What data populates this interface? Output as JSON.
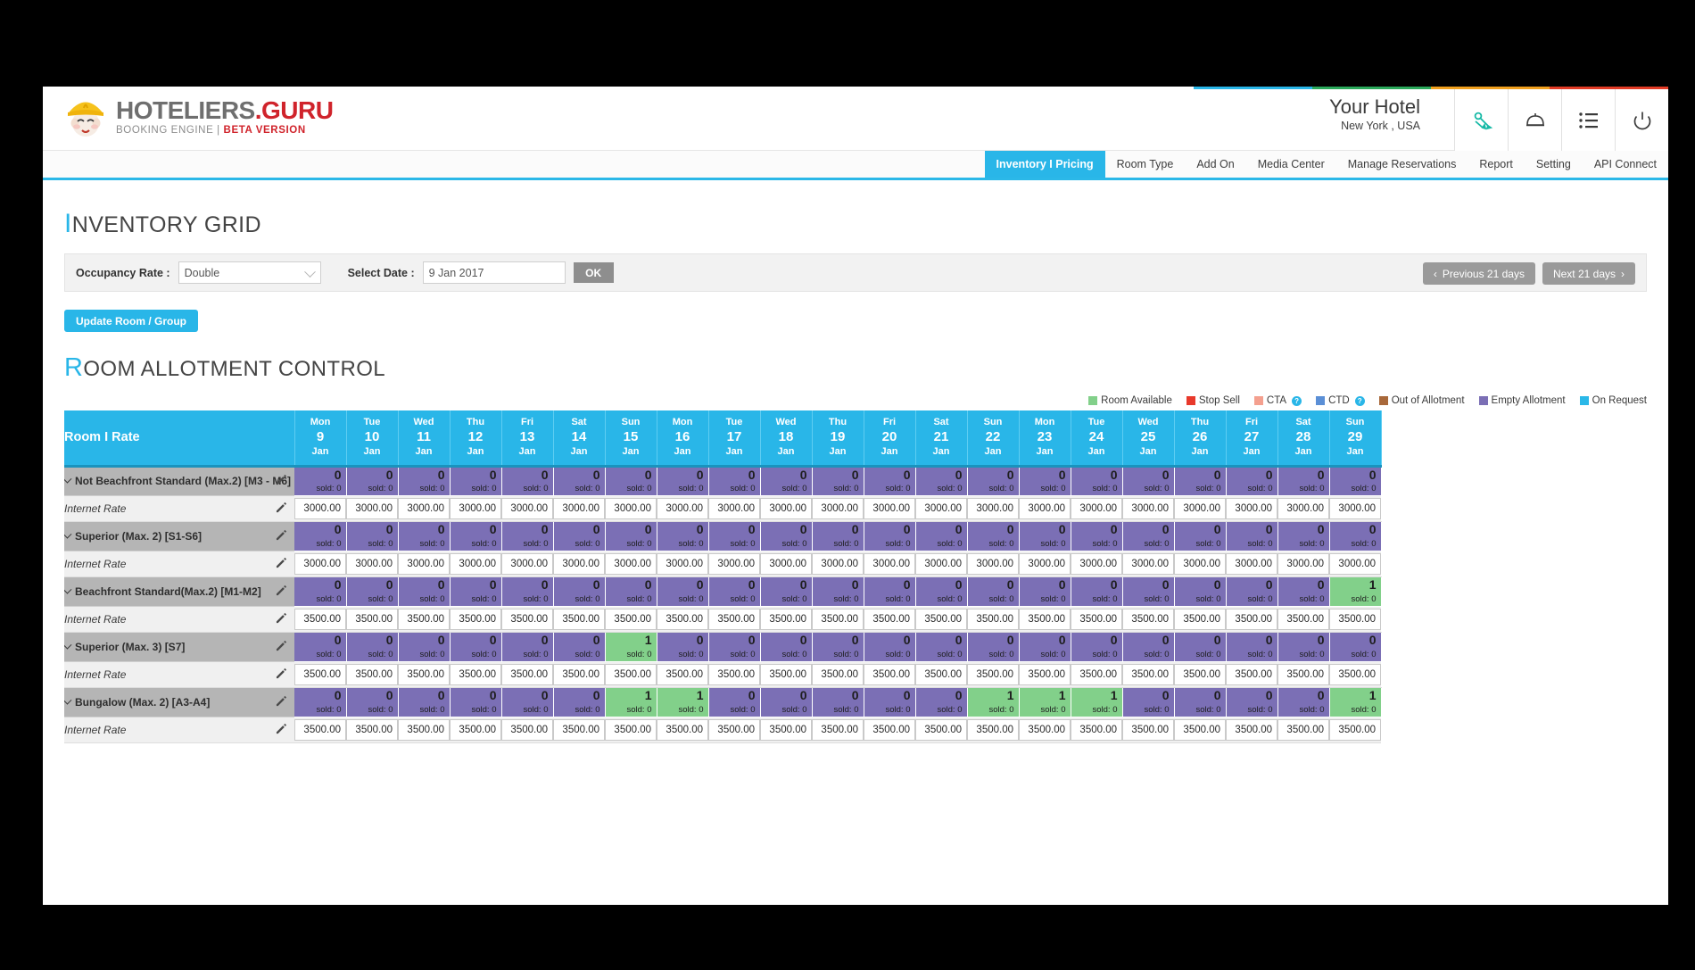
{
  "brand": {
    "name_main": "HOTELIERS",
    "name_accent": ".GURU",
    "tagline": "BOOKING ENGINE  |",
    "tagline_accent": "BETA VERSION",
    "accent_red": "#d0232b",
    "accent_blue": "#29b6e8"
  },
  "header": {
    "hotel_name": "Your Hotel",
    "hotel_location": "New York , USA",
    "icons": [
      "promotions-icon",
      "service-bell-icon",
      "list-icon",
      "power-icon"
    ],
    "strip_colors": [
      "#29b6e8",
      "#2aa85a",
      "#f0a01e",
      "#e23b26"
    ]
  },
  "nav": {
    "items": [
      {
        "label": "Inventory I Pricing",
        "active": true
      },
      {
        "label": "Room Type",
        "active": false
      },
      {
        "label": "Add On",
        "active": false
      },
      {
        "label": "Media Center",
        "active": false
      },
      {
        "label": "Manage Reservations",
        "active": false
      },
      {
        "label": "Report",
        "active": false
      },
      {
        "label": "Setting",
        "active": false
      },
      {
        "label": "API Connect",
        "active": false
      }
    ]
  },
  "page": {
    "title_cap": "I",
    "title_rest": "NVENTORY GRID",
    "section_cap": "R",
    "section_rest": "OOM ALLOTMENT CONTROL"
  },
  "filters": {
    "occupancy_label": "Occupancy Rate :",
    "occupancy_value": "Double",
    "date_label": "Select Date :",
    "date_value": "9 Jan 2017",
    "ok_label": "OK",
    "prev_label": "Previous 21 days",
    "next_label": "Next 21 days",
    "update_label": "Update Room / Group"
  },
  "legend": [
    {
      "label": "Room Available",
      "color": "#82d08a",
      "info": false
    },
    {
      "label": "Stop Sell",
      "color": "#e8392b",
      "info": false
    },
    {
      "label": "CTA",
      "color": "#f4a08f",
      "info": true
    },
    {
      "label": "CTD",
      "color": "#5b8fd6",
      "info": true
    },
    {
      "label": "Out of Allotment",
      "color": "#a8683a",
      "info": false
    },
    {
      "label": "Empty Allotment",
      "color": "#7b6fb5",
      "info": false
    },
    {
      "label": "On Request",
      "color": "#2bb8e8",
      "info": false
    }
  ],
  "grid": {
    "room_header": "Room I Rate",
    "rate_row_label": "Internet Rate",
    "sold_prefix": "sold: ",
    "days": [
      {
        "dow": "Mon",
        "num": "9",
        "mon": "Jan"
      },
      {
        "dow": "Tue",
        "num": "10",
        "mon": "Jan"
      },
      {
        "dow": "Wed",
        "num": "11",
        "mon": "Jan"
      },
      {
        "dow": "Thu",
        "num": "12",
        "mon": "Jan"
      },
      {
        "dow": "Fri",
        "num": "13",
        "mon": "Jan"
      },
      {
        "dow": "Sat",
        "num": "14",
        "mon": "Jan"
      },
      {
        "dow": "Sun",
        "num": "15",
        "mon": "Jan"
      },
      {
        "dow": "Mon",
        "num": "16",
        "mon": "Jan"
      },
      {
        "dow": "Tue",
        "num": "17",
        "mon": "Jan"
      },
      {
        "dow": "Wed",
        "num": "18",
        "mon": "Jan"
      },
      {
        "dow": "Thu",
        "num": "19",
        "mon": "Jan"
      },
      {
        "dow": "Fri",
        "num": "20",
        "mon": "Jan"
      },
      {
        "dow": "Sat",
        "num": "21",
        "mon": "Jan"
      },
      {
        "dow": "Sun",
        "num": "22",
        "mon": "Jan"
      },
      {
        "dow": "Mon",
        "num": "23",
        "mon": "Jan"
      },
      {
        "dow": "Tue",
        "num": "24",
        "mon": "Jan"
      },
      {
        "dow": "Wed",
        "num": "25",
        "mon": "Jan"
      },
      {
        "dow": "Thu",
        "num": "26",
        "mon": "Jan"
      },
      {
        "dow": "Fri",
        "num": "27",
        "mon": "Jan"
      },
      {
        "dow": "Sat",
        "num": "28",
        "mon": "Jan"
      },
      {
        "dow": "Sun",
        "num": "29",
        "mon": "Jan"
      }
    ],
    "rooms": [
      {
        "name": "Not Beachfront Standard (Max.2) [M3 - M6]",
        "allotment": [
          0,
          0,
          0,
          0,
          0,
          0,
          0,
          0,
          0,
          0,
          0,
          0,
          0,
          0,
          0,
          0,
          0,
          0,
          0,
          0,
          0
        ],
        "sold": [
          0,
          0,
          0,
          0,
          0,
          0,
          0,
          0,
          0,
          0,
          0,
          0,
          0,
          0,
          0,
          0,
          0,
          0,
          0,
          0,
          0
        ],
        "rates": [
          "3000.00",
          "3000.00",
          "3000.00",
          "3000.00",
          "3000.00",
          "3000.00",
          "3000.00",
          "3000.00",
          "3000.00",
          "3000.00",
          "3000.00",
          "3000.00",
          "3000.00",
          "3000.00",
          "3000.00",
          "3000.00",
          "3000.00",
          "3000.00",
          "3000.00",
          "3000.00",
          "3000.00"
        ]
      },
      {
        "name": "Superior (Max. 2) [S1-S6]",
        "allotment": [
          0,
          0,
          0,
          0,
          0,
          0,
          0,
          0,
          0,
          0,
          0,
          0,
          0,
          0,
          0,
          0,
          0,
          0,
          0,
          0,
          0
        ],
        "sold": [
          0,
          0,
          0,
          0,
          0,
          0,
          0,
          0,
          0,
          0,
          0,
          0,
          0,
          0,
          0,
          0,
          0,
          0,
          0,
          0,
          0
        ],
        "rates": [
          "3000.00",
          "3000.00",
          "3000.00",
          "3000.00",
          "3000.00",
          "3000.00",
          "3000.00",
          "3000.00",
          "3000.00",
          "3000.00",
          "3000.00",
          "3000.00",
          "3000.00",
          "3000.00",
          "3000.00",
          "3000.00",
          "3000.00",
          "3000.00",
          "3000.00",
          "3000.00",
          "3000.00"
        ]
      },
      {
        "name": "Beachfront Standard(Max.2) [M1-M2]",
        "allotment": [
          0,
          0,
          0,
          0,
          0,
          0,
          0,
          0,
          0,
          0,
          0,
          0,
          0,
          0,
          0,
          0,
          0,
          0,
          0,
          0,
          1
        ],
        "sold": [
          0,
          0,
          0,
          0,
          0,
          0,
          0,
          0,
          0,
          0,
          0,
          0,
          0,
          0,
          0,
          0,
          0,
          0,
          0,
          0,
          0
        ],
        "rates": [
          "3500.00",
          "3500.00",
          "3500.00",
          "3500.00",
          "3500.00",
          "3500.00",
          "3500.00",
          "3500.00",
          "3500.00",
          "3500.00",
          "3500.00",
          "3500.00",
          "3500.00",
          "3500.00",
          "3500.00",
          "3500.00",
          "3500.00",
          "3500.00",
          "3500.00",
          "3500.00",
          "3500.00"
        ]
      },
      {
        "name": "Superior (Max. 3) [S7]",
        "allotment": [
          0,
          0,
          0,
          0,
          0,
          0,
          1,
          0,
          0,
          0,
          0,
          0,
          0,
          0,
          0,
          0,
          0,
          0,
          0,
          0,
          0
        ],
        "sold": [
          0,
          0,
          0,
          0,
          0,
          0,
          0,
          0,
          0,
          0,
          0,
          0,
          0,
          0,
          0,
          0,
          0,
          0,
          0,
          0,
          0
        ],
        "rates": [
          "3500.00",
          "3500.00",
          "3500.00",
          "3500.00",
          "3500.00",
          "3500.00",
          "3500.00",
          "3500.00",
          "3500.00",
          "3500.00",
          "3500.00",
          "3500.00",
          "3500.00",
          "3500.00",
          "3500.00",
          "3500.00",
          "3500.00",
          "3500.00",
          "3500.00",
          "3500.00",
          "3500.00"
        ]
      },
      {
        "name": "Bungalow (Max. 2) [A3-A4]",
        "allotment": [
          0,
          0,
          0,
          0,
          0,
          0,
          1,
          1,
          0,
          0,
          0,
          0,
          0,
          1,
          1,
          1,
          0,
          0,
          0,
          0,
          1
        ],
        "sold": [
          0,
          0,
          0,
          0,
          0,
          0,
          0,
          0,
          0,
          0,
          0,
          0,
          0,
          0,
          0,
          0,
          0,
          0,
          0,
          0,
          0
        ],
        "rates": [
          "3500.00",
          "3500.00",
          "3500.00",
          "3500.00",
          "3500.00",
          "3500.00",
          "3500.00",
          "3500.00",
          "3500.00",
          "3500.00",
          "3500.00",
          "3500.00",
          "3500.00",
          "3500.00",
          "3500.00",
          "3500.00",
          "3500.00",
          "3500.00",
          "3500.00",
          "3500.00",
          "3500.00"
        ]
      }
    ]
  }
}
